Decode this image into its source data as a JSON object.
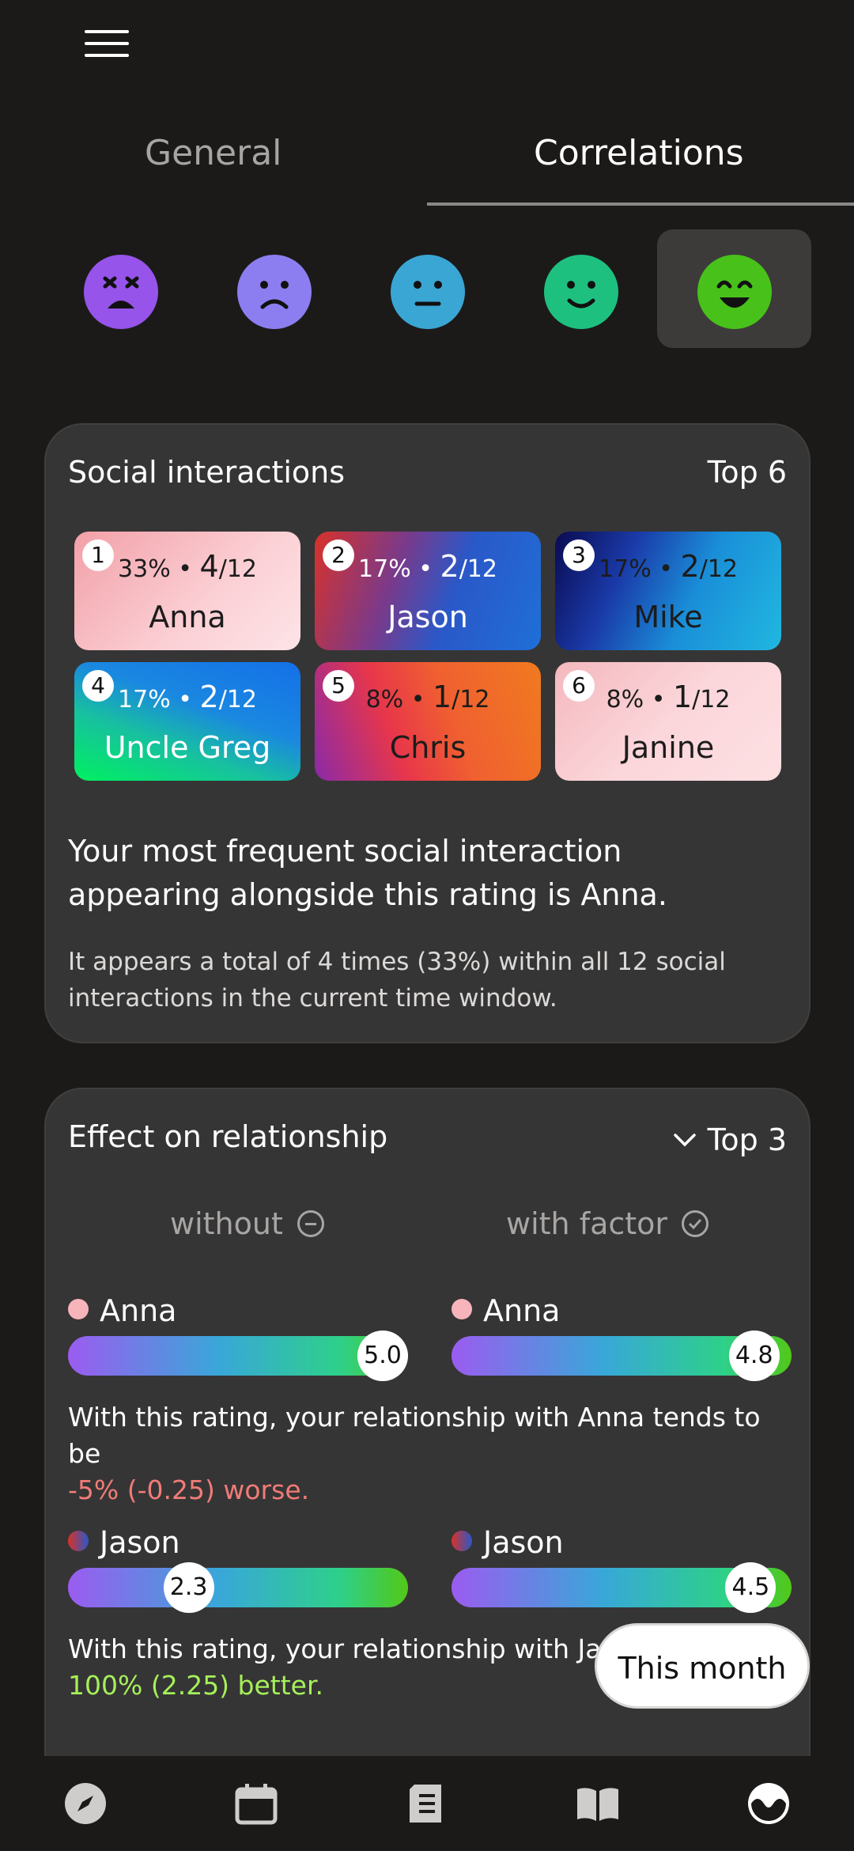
{
  "tabs": {
    "general": "General",
    "correlations": "Correlations"
  },
  "moods": [
    {
      "name": "awful",
      "color": "#9654ea"
    },
    {
      "name": "bad",
      "color": "#8c7ef0"
    },
    {
      "name": "meh",
      "color": "#3aa6d4"
    },
    {
      "name": "good",
      "color": "#1ec080"
    },
    {
      "name": "rad",
      "color": "#48c21a",
      "selected": true
    }
  ],
  "social": {
    "title": "Social interactions",
    "top_label": "Top 6",
    "tiles": [
      {
        "rank": "1",
        "pct": "33% •",
        "count": "4",
        "total": "/12",
        "name": "Anna"
      },
      {
        "rank": "2",
        "pct": "17% •",
        "count": "2",
        "total": "/12",
        "name": "Jason"
      },
      {
        "rank": "3",
        "pct": "17% •",
        "count": "2",
        "total": "/12",
        "name": "Mike"
      },
      {
        "rank": "4",
        "pct": "17% •",
        "count": "2",
        "total": "/12",
        "name": "Uncle Greg"
      },
      {
        "rank": "5",
        "pct": "8% •",
        "count": "1",
        "total": "/12",
        "name": "Chris"
      },
      {
        "rank": "6",
        "pct": "8% •",
        "count": "1",
        "total": "/12",
        "name": "Janine"
      }
    ],
    "summary": "Your most frequent social interaction appearing alongside this rating is Anna.",
    "detail": "It appears a total of 4 times (33%) within all 12 social interactions in the current time window."
  },
  "effect": {
    "title": "Effect on relationship",
    "top_label": "Top 3",
    "without_label": "without",
    "with_label": "with factor",
    "rows": [
      {
        "name": "Anna",
        "without_value": "5.0",
        "without_level": 0.93,
        "with_value": "4.8",
        "with_level": 0.89,
        "text_prefix": "With this rating, your relationship with Anna tends to be",
        "change": "-5% (-0.25) worse."
      },
      {
        "name": "Jason",
        "without_value": "2.3",
        "without_level": 0.355,
        "with_value": "4.5",
        "with_level": 0.88,
        "text_prefix": "With this rating, your relationship with Jas",
        "change": "100% (2.25) better."
      }
    ]
  },
  "time_pill": "This month",
  "nav": [
    "compass-icon",
    "calendar-icon",
    "entries-icon",
    "book-icon",
    "stats-icon"
  ]
}
